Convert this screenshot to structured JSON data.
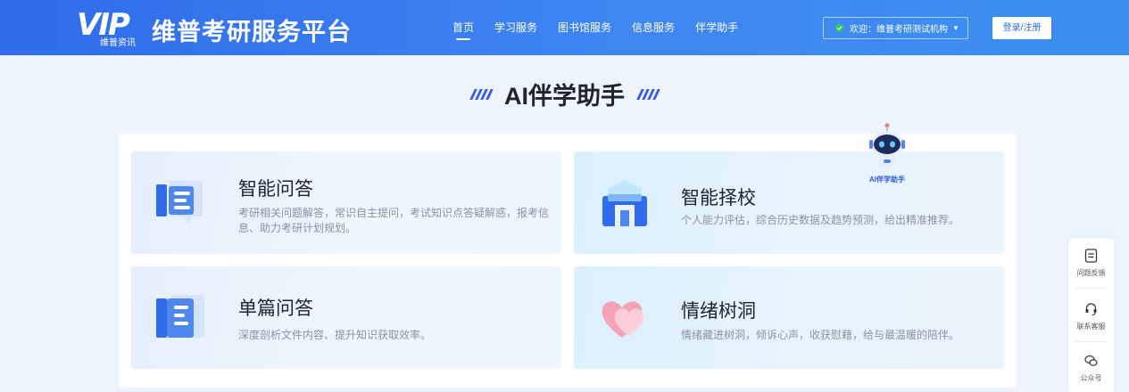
{
  "header": {
    "logo_text": "VIP",
    "logo_sub": "维普资讯",
    "brand_title": "维普考研服务平台",
    "nav": [
      {
        "label": "首页",
        "active": true
      },
      {
        "label": "学习服务",
        "active": false
      },
      {
        "label": "图书馆服务",
        "active": false
      },
      {
        "label": "信息服务",
        "active": false
      },
      {
        "label": "伴学助手",
        "active": false
      }
    ],
    "welcome": "欢迎：维普考研测试机构",
    "login_label": "登录/注册"
  },
  "main": {
    "title": "AI伴学助手",
    "cards": [
      {
        "title": "智能问答",
        "desc": "考研相关问题解答，常识自主提问，考试知识点答疑解惑，报考信息、助力考研计划规划。",
        "icon": "document-icon"
      },
      {
        "title": "智能择校",
        "desc": "个人能力评估，综合历史数据及趋势预测，给出精准推荐。",
        "icon": "school-building-icon"
      },
      {
        "title": "单篇问答",
        "desc": "深度剖析文件内容、提升知识获取效率。",
        "icon": "file-icon"
      },
      {
        "title": "情绪树洞",
        "desc": "情绪藏进树洞，倾诉心声，收获慰藉，给与最温暖的陪伴。",
        "icon": "heart-icon"
      }
    ],
    "assistant_label": "AI伴学助手"
  },
  "side_tools": [
    {
      "label": "问题反馈",
      "icon": "feedback-icon"
    },
    {
      "label": "联系客服",
      "icon": "headset-icon"
    },
    {
      "label": "公众号",
      "icon": "wechat-icon"
    }
  ],
  "colors": {
    "header_start": "#2f6bea",
    "header_end": "#3a8ff0",
    "accent": "#3a58e6",
    "login_text": "#2d6be5"
  }
}
